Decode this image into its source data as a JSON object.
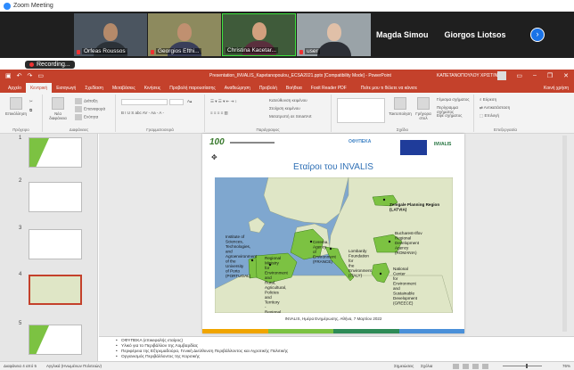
{
  "zoom": {
    "window_title": "Zoom Meeting",
    "participants": [
      {
        "name": "Orfeas Roussos"
      },
      {
        "name": "Georgios Efthi..."
      },
      {
        "name": "Christina Kacetar..."
      },
      {
        "name": "user"
      }
    ],
    "name_tiles": [
      "Magda Simou",
      "Giorgos Liotsos"
    ],
    "recording_label": "Recording...",
    "next_icon": "chevron-right-icon"
  },
  "ppt": {
    "title": "Presentation_INVALIS_Kapetanopoulou_ECSA2021.pptx [Compatibility Mode] - PowerPoint",
    "user": "ΚΑΠΕΤΑΝΟΠΟΥΛΟΥ ΧΡΙΣΤΙΝΑ",
    "tabs": [
      "Αρχείο",
      "Κεντρική",
      "Εισαγωγή",
      "Σχεδίαση",
      "Μεταβάσεις",
      "Κινήσεις",
      "Προβολή παρουσίασης",
      "Αναθεώρηση",
      "Προβολή",
      "Βοήθεια",
      "Foxit Reader PDF"
    ],
    "tell_me": "Πείτε μου τι θέλετε να κάνετε",
    "share": "Κοινή χρήση",
    "ribbon": {
      "clipboard": {
        "label": "Πρόχειρο",
        "paste": "Επικόλληση"
      },
      "slides": {
        "label": "Διαφάνειες",
        "new_slide": "Νέα διαφάνεια",
        "layout": "Διάταξη",
        "reset": "Επαναφορά",
        "section": "Ενότητα"
      },
      "font": {
        "label": "Γραμματοσειρά",
        "format_row": "B I U S abc AV - Aa - A -"
      },
      "paragraph": {
        "label": "Παράγραφος",
        "text_direction": "Κατεύθυνση κειμένου",
        "align_text": "Στοίχιση κειμένου",
        "convert": "Μετατροπή σε SmartArt"
      },
      "drawing": {
        "label": "Σχέδιο",
        "arrange": "Τακτοποίηση",
        "quick_styles": "Γρήγορα στυλ",
        "fill": "Γέμισμα σχήματος",
        "outline": "Περίγραμμα σχήματος",
        "effects": "Εφέ σχήματος"
      },
      "editing": {
        "label": "Επεξεργασία",
        "find": "Εύρεση",
        "replace": "Αντικατάσταση",
        "select": "Επιλογή"
      }
    }
  },
  "thumbnails": [
    {
      "num": "1"
    },
    {
      "num": "2"
    },
    {
      "num": "3"
    },
    {
      "num": "4",
      "selected": true
    },
    {
      "num": "5"
    }
  ],
  "slide": {
    "logo_100": "100",
    "logo_ofypeka": "ΟΦΥΠΕΚΑ",
    "logo_invalis": "INVALIS",
    "title": "Εταίροι του INVALIS",
    "caption": "INVALIS, Ημέρα Ενημέρωσης, Αθήνα, 7 Μαρτίου 2022",
    "map_labels": {
      "latvia": "Zemgale Planning Region (LATVIA)",
      "portugal": "Institute of Sciences, Technologies, and Agroenvironment of the University of Porto (PORTUGAL)",
      "spain": "Regional Ministry for Environment and Rural, Agricultural, Policies and Territory - Regional Government of Extremadura (SPAIN)",
      "france": "Cerema, Agency of Environment (FRANCE)",
      "italy": "Lombardy Foundation for the Environment (ITALY)",
      "romania": "Bucharest-Ilfov Regional Development Agency (ROMANIA)",
      "greece": "National Center for Environment and Sustainable Development (GREECE)"
    }
  },
  "notes": [
    "ΟΦΥΠΕΚΑ (επικεφαλής εταίρος)",
    "Υλικό για το Περιβάλλον της Λομβαρδίας",
    "Περιφέρεια της Εξτρεμαδούρα, Γενική Διεύθυνση Περιβάλλοντος και Αγροτικής Πολιτικής",
    "Οργανισμός Περιβάλλοντος της Κορσικής"
  ],
  "status": {
    "slide_indicator": "Διαφάνεια 4 από 5",
    "language": "Αγγλικά (Ηνωμένων Πολιτειών)",
    "notes": "Σημειώσεις",
    "comments": "Σχόλια",
    "zoom": "76%"
  },
  "colors": {
    "ppt_red": "#c4412b",
    "map_highlight": "#7cc242",
    "map_land": "#dfe6c6",
    "map_sea": "#7fa7cf",
    "title_blue": "#2e6fb5"
  }
}
